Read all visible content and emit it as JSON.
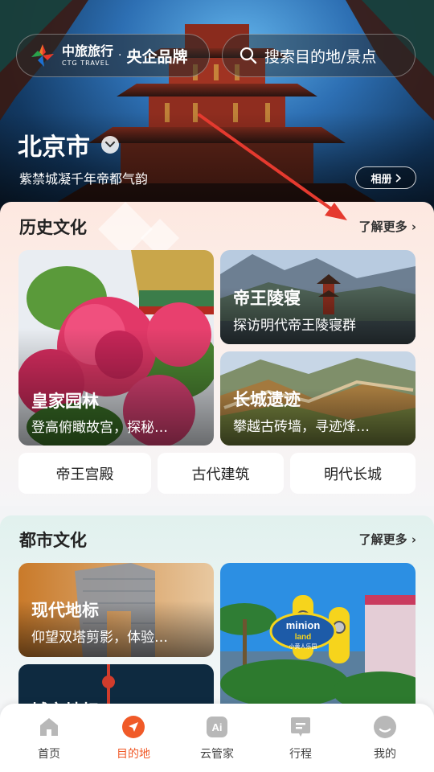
{
  "header": {
    "brand_cn": "中旅旅行",
    "brand_en": "CTG TRAVEL",
    "brand_dot": "·",
    "brand_tag": "央企品牌",
    "search_placeholder": "搜索目的地/景点"
  },
  "city": {
    "name": "北京市",
    "subtitle": "紫禁城凝千年帝都气韵",
    "album_button": "相册"
  },
  "history": {
    "title": "历史文化",
    "more": "了解更多",
    "cards": [
      {
        "label": "皇家园林",
        "desc": "登高俯瞰故宫，探秘…"
      },
      {
        "label": "帝王陵寝",
        "desc": "探访明代帝王陵寝群"
      },
      {
        "label": "长城遗迹",
        "desc": "攀越古砖墙，寻迹烽…"
      }
    ],
    "chips": [
      "帝王宫殿",
      "古代建筑",
      "明代长城"
    ]
  },
  "urban": {
    "title": "都市文化",
    "more": "了解更多",
    "cards": [
      {
        "label": "现代地标",
        "desc": "仰望双塔剪影，体验…"
      },
      {
        "label": "城市地标",
        "desc": ""
      },
      {
        "label": "",
        "desc": "",
        "sign_line1": "minion",
        "sign_line2": "land",
        "sign_line3": "小黄人乐园"
      }
    ]
  },
  "tabbar": {
    "items": [
      {
        "label": "首页",
        "icon": "home-icon"
      },
      {
        "label": "目的地",
        "icon": "destination-icon"
      },
      {
        "label": "云管家",
        "icon": "ai-icon",
        "icon_text": "Ai"
      },
      {
        "label": "行程",
        "icon": "itinerary-icon"
      },
      {
        "label": "我的",
        "icon": "profile-icon"
      }
    ],
    "active_color": "#f05a28"
  }
}
